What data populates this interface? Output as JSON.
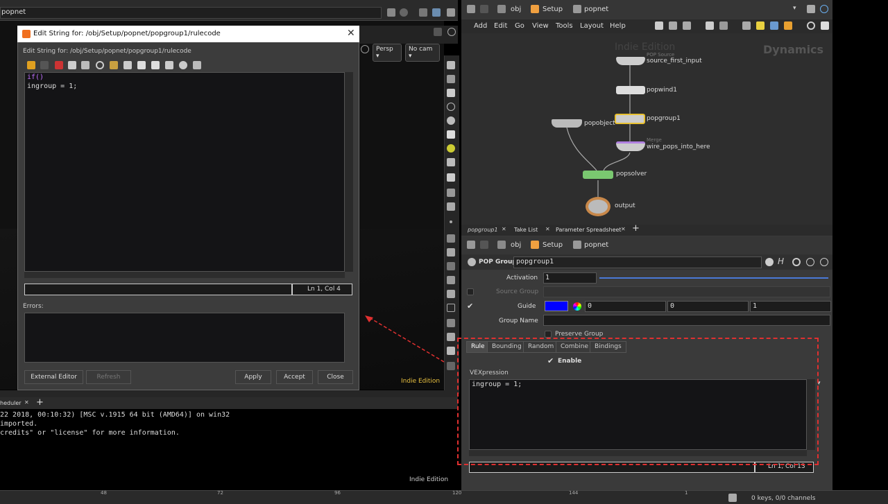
{
  "topbar": {
    "path": "popnet",
    "tab1": "...",
    "indie_left": "Indie Edition"
  },
  "dialog": {
    "title": "Edit String for: /obj/Setup/popnet/popgroup1/rulecode",
    "subtitle": "Edit String for: /obj/Setup/popnet/popgroup1/rulecode",
    "code_line1": "if()",
    "code_line2": "ingroup = 1;",
    "status": "Ln 1, Col 4",
    "errors_label": "Errors:",
    "buttons": {
      "external": "External Editor",
      "refresh": "Refresh",
      "apply": "Apply",
      "accept": "Accept",
      "close": "Close"
    }
  },
  "viewport": {
    "persp": "Persp",
    "nocam": "No cam",
    "indie": "Indie Edition"
  },
  "console": {
    "tab": "heduler",
    "line1": "22 2018, 00:10:32) [MSC v.1915 64 bit (AMD64)] on win32",
    "line2": " imported.",
    "line3": "credits\" or \"license\" for more information.",
    "indie": "Indie Edition"
  },
  "network": {
    "path": {
      "obj": "obj",
      "setup": "Setup",
      "popnet": "popnet"
    },
    "menu": [
      "Add",
      "Edit",
      "Go",
      "View",
      "Tools",
      "Layout",
      "Help"
    ],
    "watermark": "Indie Edition",
    "context": "Dynamics",
    "nodes": {
      "source_sub": "POP Source",
      "source": "source_first_input",
      "wind": "popwind1",
      "group": "popgroup1",
      "object": "popobject",
      "merge_sub": "Merge",
      "merge": "wire_pops_into_here",
      "solver": "popsolver",
      "output": "output"
    }
  },
  "params": {
    "tabs": [
      "popgroup1",
      "Take List",
      "Parameter Spreadsheet"
    ],
    "path": {
      "obj": "obj",
      "setup": "Setup",
      "popnet": "popnet"
    },
    "node_type": "POP Group",
    "node_name": "popgroup1",
    "activation_label": "Activation",
    "activation": "1",
    "source_group_label": "Source Group",
    "guide_label": "Guide",
    "guide_color": "#0000ff",
    "guide_vals": [
      "0",
      "0",
      "1"
    ],
    "group_name_label": "Group Name",
    "preserve_label": "Preserve Group",
    "sub_tabs": [
      "Rule",
      "Bounding",
      "Random",
      "Combine",
      "Bindings"
    ],
    "enable_label": "Enable",
    "vex_label": "VEXpression",
    "vex_code": "ingroup = 1;",
    "vex_status": "Ln 1, Col 13"
  },
  "timeline": {
    "ticks": [
      "48",
      "72",
      "96",
      "120",
      "144",
      "1"
    ],
    "keys": "0 keys, 0/0 channels"
  }
}
